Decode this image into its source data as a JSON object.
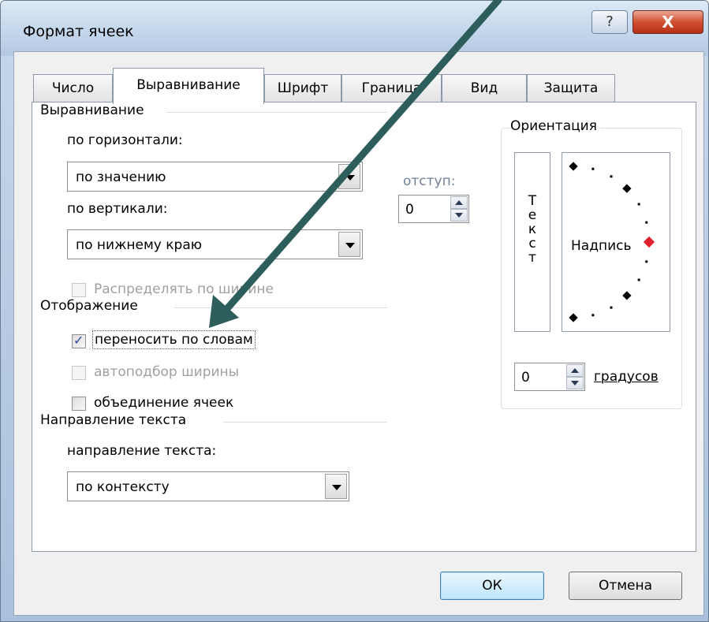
{
  "window": {
    "title": "Формат ячеек",
    "help_label": "?",
    "close_label": "X"
  },
  "tabs": [
    {
      "label": "Число",
      "active": false
    },
    {
      "label": "Выравнивание",
      "active": true
    },
    {
      "label": "Шрифт",
      "active": false
    },
    {
      "label": "Граница",
      "active": false
    },
    {
      "label": "Вид",
      "active": false
    },
    {
      "label": "Защита",
      "active": false
    }
  ],
  "alignment": {
    "group_title": "Выравнивание",
    "horizontal_label": "по горизонтали:",
    "horizontal_value": "по значению",
    "indent_label": "отступ:",
    "indent_value": "0",
    "vertical_label": "по вертикали:",
    "vertical_value": "по нижнему краю",
    "distribute_label": "Распределять по ширине",
    "distribute_checked": false
  },
  "display": {
    "group_title": "Отображение",
    "wrap_label": "переносить по словам",
    "wrap_checked": true,
    "shrink_label": "автоподбор ширины",
    "shrink_checked": false,
    "merge_label": "объединение ячеек",
    "merge_checked": false
  },
  "direction": {
    "group_title": "Направление текста",
    "direction_label": "направление текста:",
    "direction_value": "по контексту"
  },
  "orientation": {
    "group_title": "Ориентация",
    "vertical_text": "Т\nе\nк\nс\nт",
    "dial_label": "Надпись",
    "degrees_value": "0",
    "degrees_label": "градусов"
  },
  "buttons": {
    "ok": "ОК",
    "cancel": "Отмена"
  },
  "colors": {
    "annotation_arrow": "#2e5e5c",
    "dial_marker": "#e0202a"
  }
}
